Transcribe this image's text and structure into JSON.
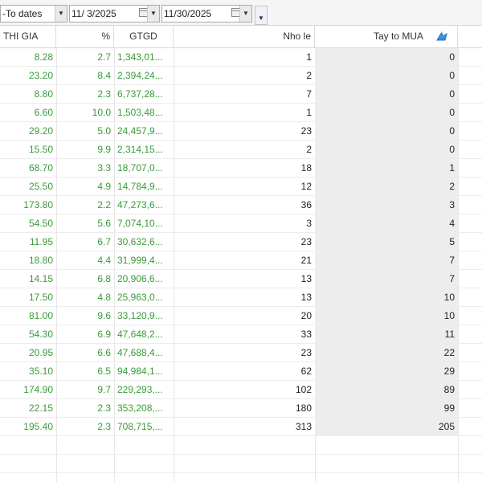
{
  "toolbar": {
    "date_mode": "-To dates",
    "from_date": "11/ 3/2025",
    "to_date": "11/30/2025"
  },
  "columns": {
    "price": "THI GIA",
    "percent": "%",
    "value": "GTGD",
    "small": "Nho le",
    "big_buy": "Tay to MUA"
  },
  "rows": [
    {
      "price": "8.28",
      "pct": "2.7",
      "value": "1,343,01...",
      "small": "1",
      "big": "0"
    },
    {
      "price": "23.20",
      "pct": "8.4",
      "value": "2,394,24...",
      "small": "2",
      "big": "0"
    },
    {
      "price": "8.80",
      "pct": "2.3",
      "value": "6,737,28...",
      "small": "7",
      "big": "0"
    },
    {
      "price": "6.60",
      "pct": "10.0",
      "value": "1,503,48...",
      "small": "1",
      "big": "0"
    },
    {
      "price": "29.20",
      "pct": "5.0",
      "value": "24,457,9...",
      "small": "23",
      "big": "0"
    },
    {
      "price": "15.50",
      "pct": "9.9",
      "value": "2,314,15...",
      "small": "2",
      "big": "0"
    },
    {
      "price": "68.70",
      "pct": "3.3",
      "value": "18,707,0...",
      "small": "18",
      "big": "1"
    },
    {
      "price": "25.50",
      "pct": "4.9",
      "value": "14,784,9...",
      "small": "12",
      "big": "2"
    },
    {
      "price": "173.80",
      "pct": "2.2",
      "value": "47,273,6...",
      "small": "36",
      "big": "3"
    },
    {
      "price": "54.50",
      "pct": "5.6",
      "value": "7,074,10...",
      "small": "3",
      "big": "4"
    },
    {
      "price": "11.95",
      "pct": "6.7",
      "value": "30,632,6...",
      "small": "23",
      "big": "5"
    },
    {
      "price": "18.80",
      "pct": "4.4",
      "value": "31,999,4...",
      "small": "21",
      "big": "7"
    },
    {
      "price": "14.15",
      "pct": "6.8",
      "value": "20,906,6...",
      "small": "13",
      "big": "7"
    },
    {
      "price": "17.50",
      "pct": "4.8",
      "value": "25,963,0...",
      "small": "13",
      "big": "10"
    },
    {
      "price": "81.00",
      "pct": "9.6",
      "value": "33,120,9...",
      "small": "20",
      "big": "10"
    },
    {
      "price": "54.30",
      "pct": "6.9",
      "value": "47,648,2...",
      "small": "33",
      "big": "11"
    },
    {
      "price": "20.95",
      "pct": "6.6",
      "value": "47,688,4...",
      "small": "23",
      "big": "22"
    },
    {
      "price": "35.10",
      "pct": "6.5",
      "value": "94,984,1...",
      "small": "62",
      "big": "29"
    },
    {
      "price": "174.90",
      "pct": "9.7",
      "value": "229,293,...",
      "small": "102",
      "big": "89"
    },
    {
      "price": "22.15",
      "pct": "2.3",
      "value": "353,208,...",
      "small": "180",
      "big": "99"
    },
    {
      "price": "195.40",
      "pct": "2.3",
      "value": "708,715,...",
      "small": "313",
      "big": "205"
    }
  ],
  "colors": {
    "positive": "#3a9b3a",
    "sorted_column_shade": "#ededed"
  },
  "icons": {
    "sort": "sort-descending-arrow-icon",
    "calendar": "calendar-icon",
    "dropdown": "chevron-down-icon"
  }
}
